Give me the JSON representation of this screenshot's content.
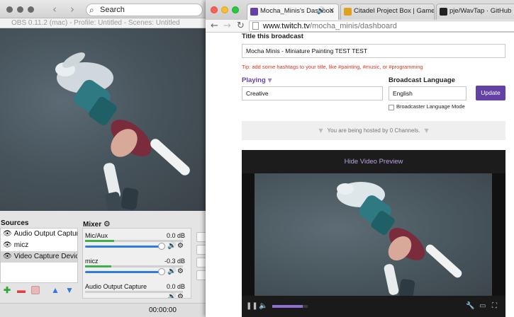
{
  "obs": {
    "search_label": "Search",
    "window_title": "OBS 0.11.2 (mac) - Profile: Untitled - Scenes: Untitled",
    "sources_title": "Sources",
    "sources": [
      {
        "label": "Audio Output Capture",
        "selected": false
      },
      {
        "label": "micz",
        "selected": false
      },
      {
        "label": "Video Capture Device",
        "selected": true
      }
    ],
    "mixer_title": "Mixer",
    "mixer": [
      {
        "name": "Mic/Aux",
        "db": "0.0 dB",
        "level": 0.3
      },
      {
        "name": "micz",
        "db": "-0.3 dB",
        "level": 0.27
      },
      {
        "name": "Audio Output Capture",
        "db": "0.0 dB",
        "level": 0.0
      }
    ],
    "timer": "00:00:00",
    "icons": [
      "eye-icon",
      "gear-icon",
      "speaker-icon",
      "plus-icon",
      "minus-icon",
      "arrow-up-icon",
      "arrow-down-icon"
    ]
  },
  "chrome": {
    "tabs": [
      {
        "label": "Mocha_Minis's Dashboa",
        "active": true,
        "favicon_color": "#6441a5"
      },
      {
        "label": "Citadel Project Box | Games",
        "active": false,
        "favicon_color": "#e0a020"
      },
      {
        "label": "pje/WavTap · GitHub",
        "active": false,
        "favicon_color": "#222222"
      }
    ],
    "url_host": "www.twitch.tv",
    "url_path": "/mocha_minis/dashboard"
  },
  "dashboard": {
    "title_label": "Title this broadcast",
    "title_value": "Mocha Minis - Miniature Painting TEST TEST",
    "tip": "Tip: add some hashtags to your title, like #painting, #music, or #programming",
    "playing_label": "Playing",
    "playing_value": "Creative",
    "language_label": "Broadcast Language",
    "language_value": "English",
    "update_label": "Update",
    "language_mode_label": "Broadcaster Language Mode",
    "hosted_text": "You are being hosted by 0 Channels.",
    "hide_preview_label": "Hide Video Preview",
    "video_progress": 0.85,
    "accent_color": "#6441a5",
    "tip_color": "#e0321f"
  }
}
